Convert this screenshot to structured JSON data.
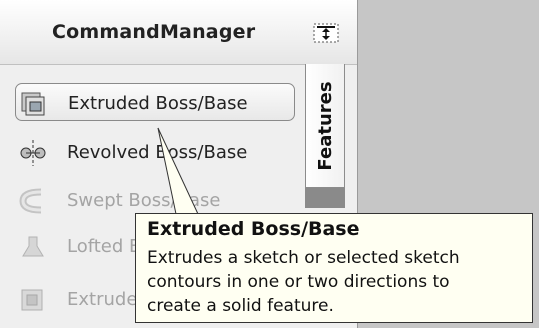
{
  "header": {
    "title": "CommandManager",
    "pin_icon": "pin-icon"
  },
  "tab": {
    "label": "Features"
  },
  "items": [
    {
      "label": "Extruded Boss/Base",
      "icon": "extruded-boss-icon",
      "state": "selected"
    },
    {
      "label": "Revolved Boss/Base",
      "icon": "revolved-boss-icon",
      "state": "enabled"
    },
    {
      "label": "Swept Boss/Base",
      "icon": "swept-boss-icon",
      "state": "disabled"
    },
    {
      "label": "Lofted Boss/Base",
      "icon": "lofted-boss-icon",
      "state": "disabled"
    },
    {
      "label": "Extruded Cut",
      "icon": "extruded-cut-icon",
      "state": "disabled"
    }
  ],
  "tooltip": {
    "title": "Extruded Boss/Base",
    "lines": [
      "Extrudes a sketch or selected sketch",
      "contours in one or two directions to",
      "create a solid feature."
    ]
  },
  "colors": {
    "panel": "#efefef",
    "background": "#c6c6c6",
    "tooltip_bg": "#fffff2",
    "disabled_text": "#a4a4a4"
  }
}
